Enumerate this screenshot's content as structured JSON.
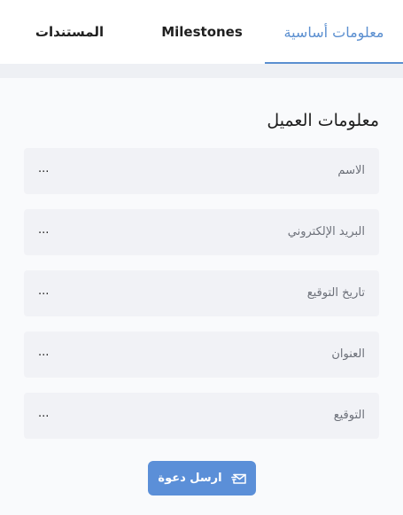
{
  "tabs": [
    {
      "label": "معلومات أساسية",
      "active": true
    },
    {
      "label": "Milestones",
      "active": false
    },
    {
      "label": "المستندات",
      "active": false
    }
  ],
  "section": {
    "title": "معلومات العميل"
  },
  "fields": [
    {
      "label": "الاسم",
      "value": "..."
    },
    {
      "label": "البريد الإلكتروني",
      "value": "..."
    },
    {
      "label": "تاريخ التوقيع",
      "value": "..."
    },
    {
      "label": "العنوان",
      "value": "..."
    },
    {
      "label": "التوقيع",
      "value": "..."
    }
  ],
  "actions": {
    "send_invite_label": "ارسل دعوة",
    "send_invite_icon": "mail-send-icon"
  },
  "colors": {
    "accent": "#5b8fd0",
    "button": "#5b8fd8",
    "field_bg": "#f1f2f6",
    "page_bg": "#f9fafc"
  }
}
